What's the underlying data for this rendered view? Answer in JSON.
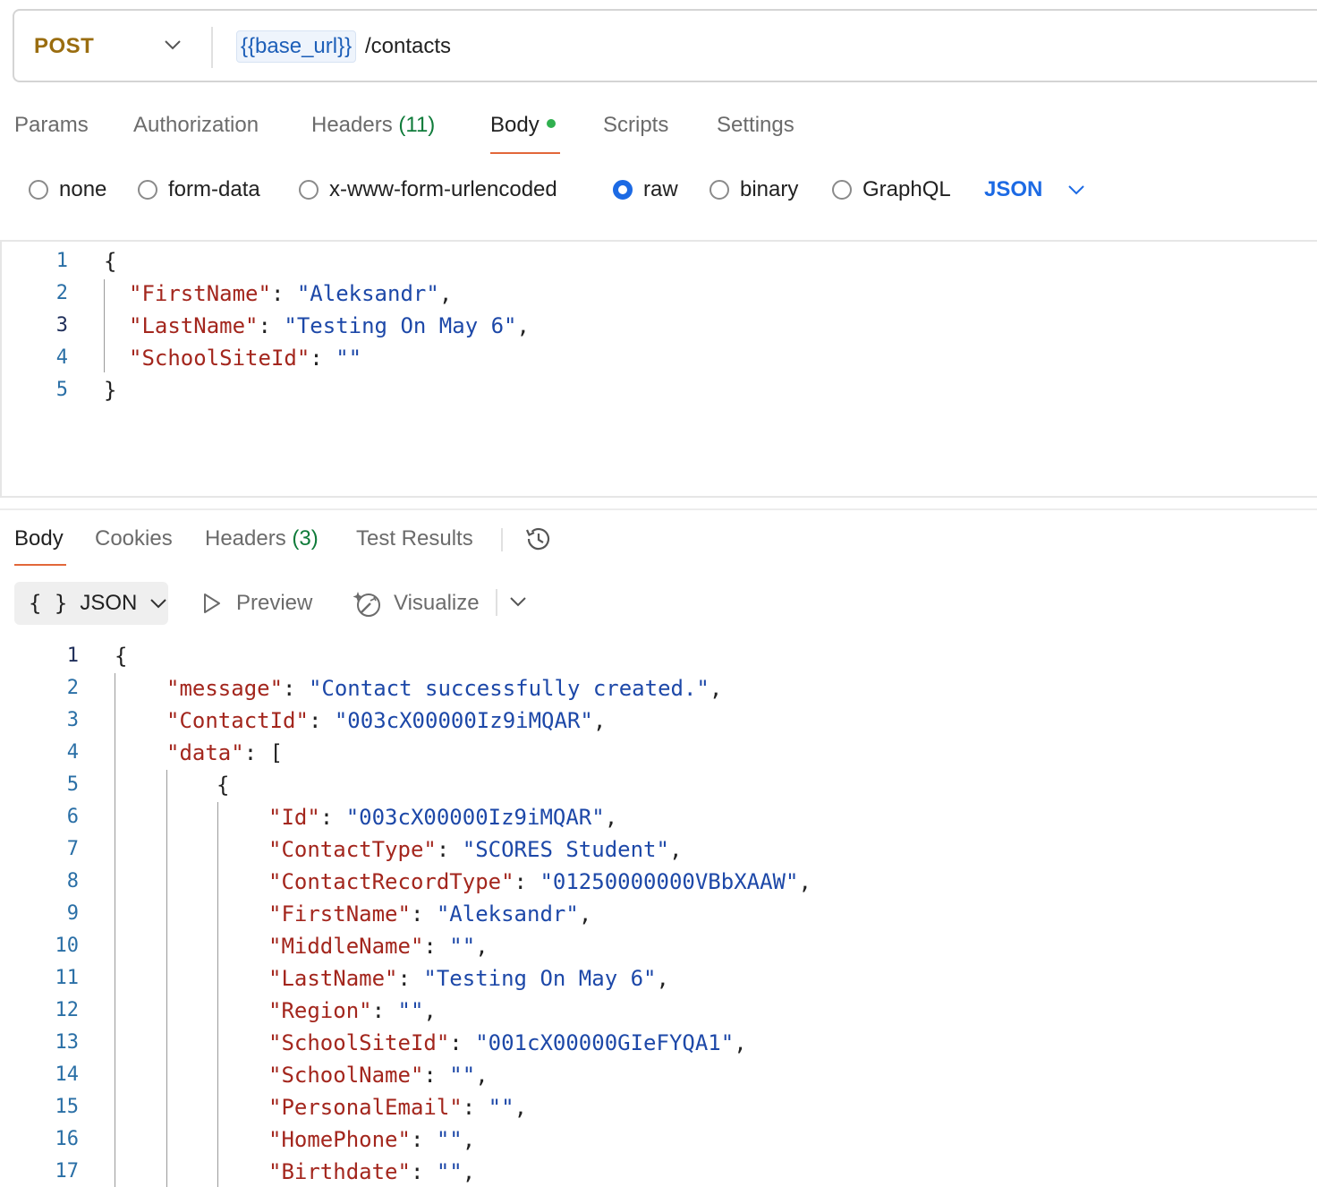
{
  "request": {
    "method": "POST",
    "url_variable": "{{base_url}}",
    "url_path": "/contacts"
  },
  "request_tabs": [
    {
      "label": "Params"
    },
    {
      "label": "Authorization"
    },
    {
      "label": "Headers",
      "count": "(11)"
    },
    {
      "label": "Body",
      "active": true,
      "indicator": "green-dot"
    },
    {
      "label": "Scripts"
    },
    {
      "label": "Settings"
    }
  ],
  "body_types": [
    {
      "label": "none",
      "checked": false
    },
    {
      "label": "form-data",
      "checked": false
    },
    {
      "label": "x-www-form-urlencoded",
      "checked": false
    },
    {
      "label": "raw",
      "checked": true
    },
    {
      "label": "binary",
      "checked": false
    },
    {
      "label": "GraphQL",
      "checked": false
    }
  ],
  "body_format": "JSON",
  "request_body": {
    "line_numbers": [
      "1",
      "2",
      "3",
      "4",
      "5"
    ],
    "current_line": "3",
    "lines": [
      [
        {
          "t": "p",
          "v": "{"
        }
      ],
      [
        {
          "t": "k",
          "v": "\"FirstName\""
        },
        {
          "t": "p",
          "v": ": "
        },
        {
          "t": "s",
          "v": "\"Aleksandr\""
        },
        {
          "t": "p",
          "v": ","
        }
      ],
      [
        {
          "t": "k",
          "v": "\"LastName\""
        },
        {
          "t": "p",
          "v": ": "
        },
        {
          "t": "s",
          "v": "\"Testing On May 6\""
        },
        {
          "t": "p",
          "v": ","
        }
      ],
      [
        {
          "t": "k",
          "v": "\"SchoolSiteId\""
        },
        {
          "t": "p",
          "v": ": "
        },
        {
          "t": "s",
          "v": "\"\""
        }
      ],
      [
        {
          "t": "p",
          "v": "}"
        }
      ]
    ]
  },
  "response_tabs": [
    {
      "label": "Body",
      "active": true
    },
    {
      "label": "Cookies"
    },
    {
      "label": "Headers",
      "count": "(3)"
    },
    {
      "label": "Test Results"
    }
  ],
  "response_toolbar": {
    "format_braces": "{ }",
    "format_label": "JSON",
    "preview_label": "Preview",
    "visualize_label": "Visualize"
  },
  "response_body": {
    "line_numbers": [
      "1",
      "2",
      "3",
      "4",
      "5",
      "6",
      "7",
      "8",
      "9",
      "10",
      "11",
      "12",
      "13",
      "14",
      "15",
      "16",
      "17"
    ],
    "current_line": "1",
    "lines": [
      [
        {
          "t": "p",
          "v": "{"
        }
      ],
      [
        {
          "t": "k",
          "v": "\"message\""
        },
        {
          "t": "p",
          "v": ": "
        },
        {
          "t": "s",
          "v": "\"Contact successfully created.\""
        },
        {
          "t": "p",
          "v": ","
        }
      ],
      [
        {
          "t": "k",
          "v": "\"ContactId\""
        },
        {
          "t": "p",
          "v": ": "
        },
        {
          "t": "s",
          "v": "\"003cX00000Iz9iMQAR\""
        },
        {
          "t": "p",
          "v": ","
        }
      ],
      [
        {
          "t": "k",
          "v": "\"data\""
        },
        {
          "t": "p",
          "v": ": ["
        }
      ],
      [
        {
          "t": "p",
          "v": "{"
        }
      ],
      [
        {
          "t": "k",
          "v": "\"Id\""
        },
        {
          "t": "p",
          "v": ": "
        },
        {
          "t": "s",
          "v": "\"003cX00000Iz9iMQAR\""
        },
        {
          "t": "p",
          "v": ","
        }
      ],
      [
        {
          "t": "k",
          "v": "\"ContactType\""
        },
        {
          "t": "p",
          "v": ": "
        },
        {
          "t": "s",
          "v": "\"SCORES Student\""
        },
        {
          "t": "p",
          "v": ","
        }
      ],
      [
        {
          "t": "k",
          "v": "\"ContactRecordType\""
        },
        {
          "t": "p",
          "v": ": "
        },
        {
          "t": "s",
          "v": "\"01250000000VBbXAAW\""
        },
        {
          "t": "p",
          "v": ","
        }
      ],
      [
        {
          "t": "k",
          "v": "\"FirstName\""
        },
        {
          "t": "p",
          "v": ": "
        },
        {
          "t": "s",
          "v": "\"Aleksandr\""
        },
        {
          "t": "p",
          "v": ","
        }
      ],
      [
        {
          "t": "k",
          "v": "\"MiddleName\""
        },
        {
          "t": "p",
          "v": ": "
        },
        {
          "t": "s",
          "v": "\"\""
        },
        {
          "t": "p",
          "v": ","
        }
      ],
      [
        {
          "t": "k",
          "v": "\"LastName\""
        },
        {
          "t": "p",
          "v": ": "
        },
        {
          "t": "s",
          "v": "\"Testing On May 6\""
        },
        {
          "t": "p",
          "v": ","
        }
      ],
      [
        {
          "t": "k",
          "v": "\"Region\""
        },
        {
          "t": "p",
          "v": ": "
        },
        {
          "t": "s",
          "v": "\"\""
        },
        {
          "t": "p",
          "v": ","
        }
      ],
      [
        {
          "t": "k",
          "v": "\"SchoolSiteId\""
        },
        {
          "t": "p",
          "v": ": "
        },
        {
          "t": "s",
          "v": "\"001cX00000GIeFYQA1\""
        },
        {
          "t": "p",
          "v": ","
        }
      ],
      [
        {
          "t": "k",
          "v": "\"SchoolName\""
        },
        {
          "t": "p",
          "v": ": "
        },
        {
          "t": "s",
          "v": "\"\""
        },
        {
          "t": "p",
          "v": ","
        }
      ],
      [
        {
          "t": "k",
          "v": "\"PersonalEmail\""
        },
        {
          "t": "p",
          "v": ": "
        },
        {
          "t": "s",
          "v": "\"\""
        },
        {
          "t": "p",
          "v": ","
        }
      ],
      [
        {
          "t": "k",
          "v": "\"HomePhone\""
        },
        {
          "t": "p",
          "v": ": "
        },
        {
          "t": "s",
          "v": "\"\""
        },
        {
          "t": "p",
          "v": ","
        }
      ],
      [
        {
          "t": "k",
          "v": "\"Birthdate\""
        },
        {
          "t": "p",
          "v": ": "
        },
        {
          "t": "s",
          "v": "\"\""
        },
        {
          "t": "p",
          "v": ","
        }
      ]
    ]
  },
  "colors": {
    "method": "#9a6d10",
    "key": "#a3261d",
    "string": "#1d48a8",
    "accent": "#e2673a",
    "radio_checked": "#1c6ae4",
    "status_dot": "#30b04f"
  },
  "icons": [
    "chevron-down-icon",
    "history-icon",
    "play-icon",
    "visualize-wand-icon"
  ]
}
